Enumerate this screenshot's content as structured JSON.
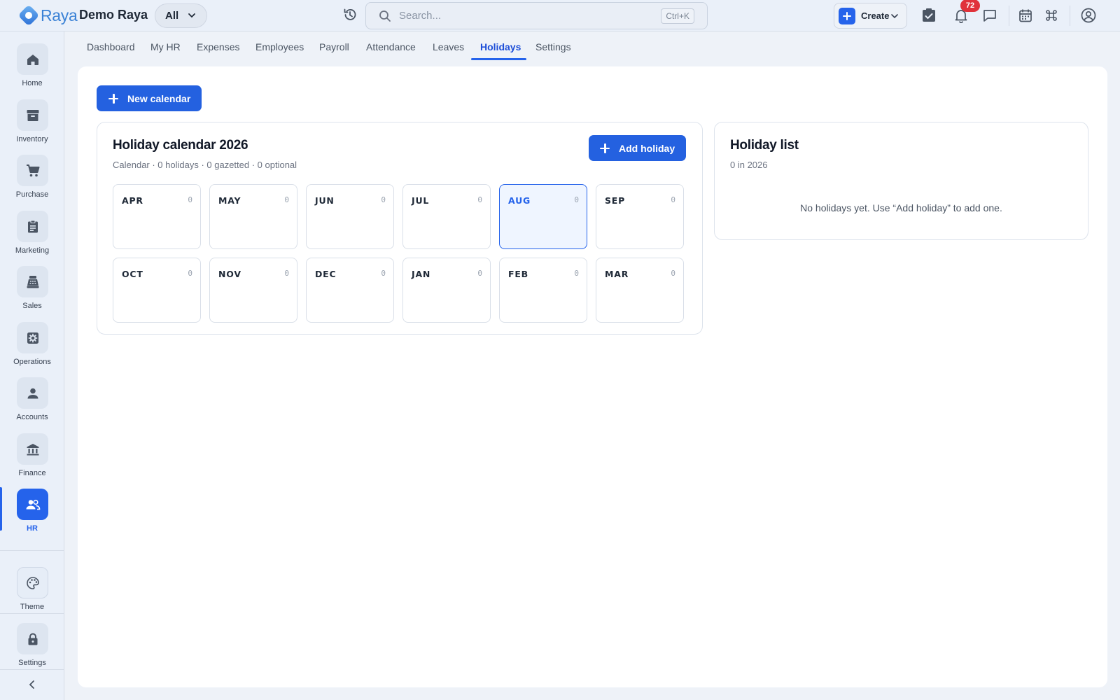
{
  "app": {
    "brand": "Raya",
    "org": "Demo Raya",
    "scope": "All",
    "search_placeholder": "Search...",
    "search_shortcut": "Ctrl+K",
    "create_label": "Create",
    "notification_count": "72",
    "accent_color": "#2563eb"
  },
  "sidebar": {
    "items": [
      {
        "label": "Home",
        "icon": "home-icon"
      },
      {
        "label": "Inventory",
        "icon": "archive-icon"
      },
      {
        "label": "Purchase",
        "icon": "cart-icon"
      },
      {
        "label": "Marketing",
        "icon": "clipboard-icon"
      },
      {
        "label": "Sales",
        "icon": "register-icon"
      },
      {
        "label": "Operations",
        "icon": "cog-box-icon"
      },
      {
        "label": "Accounts",
        "icon": "person-icon"
      },
      {
        "label": "Finance",
        "icon": "bank-icon"
      },
      {
        "label": "HR",
        "icon": "people-icon",
        "active": true
      }
    ],
    "bottom": [
      {
        "label": "Theme",
        "icon": "palette-icon"
      },
      {
        "label": "Settings",
        "icon": "lock-icon"
      }
    ]
  },
  "tabs": [
    {
      "label": "Dashboard"
    },
    {
      "label": "My HR"
    },
    {
      "label": "Expenses"
    },
    {
      "label": "Employees"
    },
    {
      "label": "Payroll"
    },
    {
      "label": "Attendance"
    },
    {
      "label": "Leaves"
    },
    {
      "label": "Holidays",
      "active": true
    },
    {
      "label": "Settings"
    }
  ],
  "page": {
    "new_calendar_label": "New calendar",
    "calendar": {
      "title": "Holiday calendar 2026",
      "subtitle": "Calendar · 0 holidays · 0 gazetted · 0 optional",
      "add_holiday_label": "Add holiday",
      "months": [
        {
          "name": "APR",
          "count": "0"
        },
        {
          "name": "MAY",
          "count": "0"
        },
        {
          "name": "JUN",
          "count": "0"
        },
        {
          "name": "JUL",
          "count": "0"
        },
        {
          "name": "AUG",
          "count": "0",
          "current": true
        },
        {
          "name": "SEP",
          "count": "0"
        },
        {
          "name": "OCT",
          "count": "0"
        },
        {
          "name": "NOV",
          "count": "0"
        },
        {
          "name": "DEC",
          "count": "0"
        },
        {
          "name": "JAN",
          "count": "0"
        },
        {
          "name": "FEB",
          "count": "0"
        },
        {
          "name": "MAR",
          "count": "0"
        }
      ]
    },
    "list": {
      "title": "Holiday list",
      "subtitle": "0 in 2026",
      "empty_message": "No holidays yet. Use “Add holiday” to add one."
    }
  }
}
